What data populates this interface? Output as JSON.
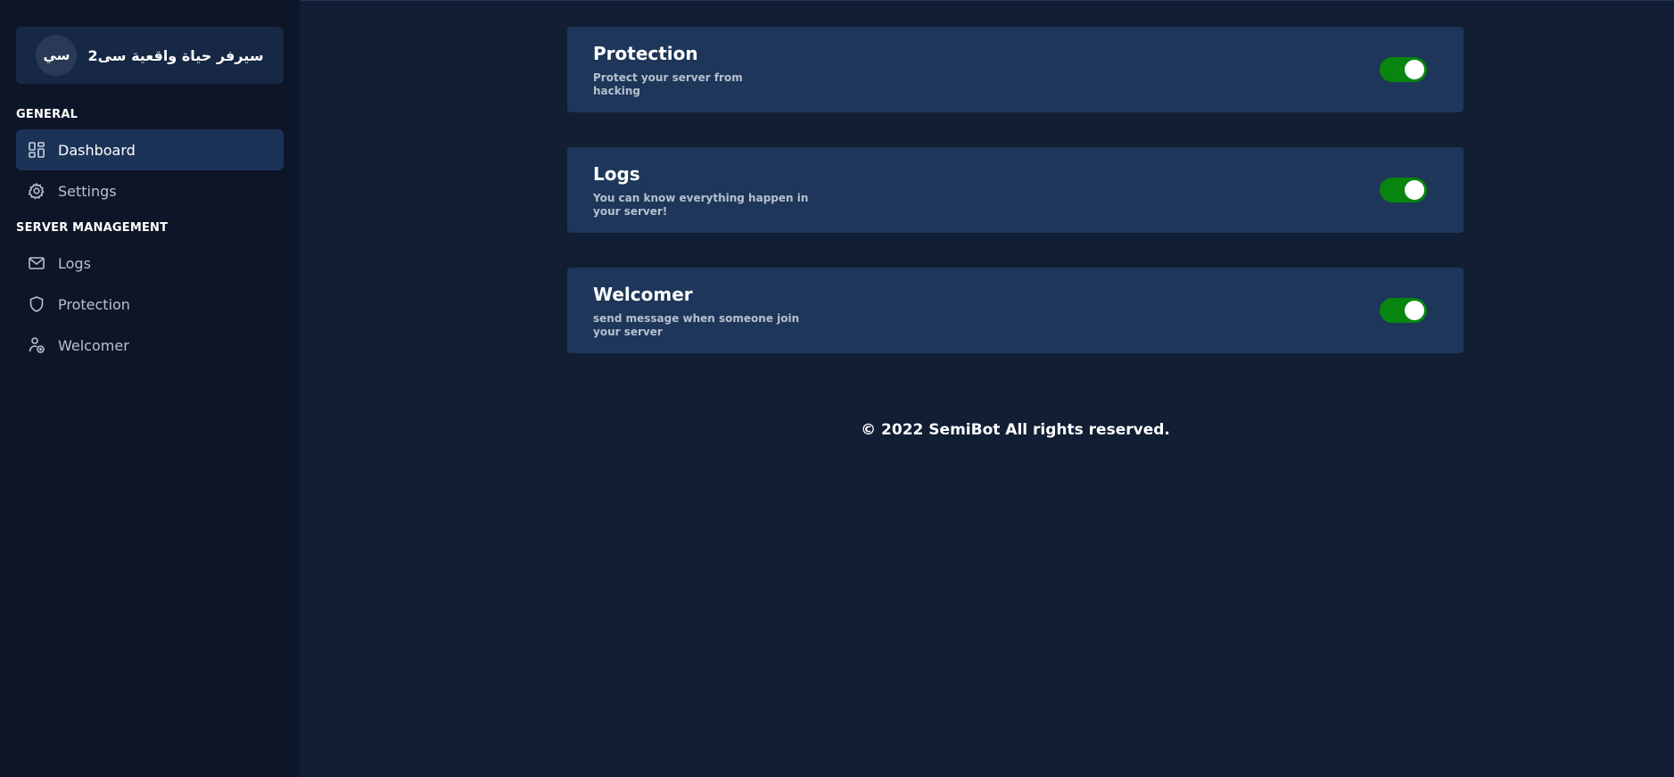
{
  "sidebar": {
    "server": {
      "avatar_text": "سي",
      "name": "سيرفر حياة واقعية سى2"
    },
    "sections": {
      "general": "GENERAL",
      "server_management": "SERVER MANAGEMENT"
    },
    "items": [
      {
        "label": "Dashboard",
        "icon": "dashboard-icon",
        "active": true
      },
      {
        "label": "Settings",
        "icon": "gear-icon",
        "active": false
      },
      {
        "label": "Logs",
        "icon": "envelope-icon",
        "active": false
      },
      {
        "label": "Protection",
        "icon": "shield-icon",
        "active": false
      },
      {
        "label": "Welcomer",
        "icon": "user-add-icon",
        "active": false
      }
    ]
  },
  "modules": [
    {
      "title": "Protection",
      "desc_line1": "Protect your server from",
      "desc_line2": "hacking",
      "enabled": true
    },
    {
      "title": "Logs",
      "desc_line1": "You can know everything happen in",
      "desc_line2": "your server!",
      "enabled": true
    },
    {
      "title": "Welcomer",
      "desc_line1": "send message when someone join",
      "desc_line2": "your server",
      "enabled": true
    }
  ],
  "footer": {
    "text": "© 2022 SemiBot All rights reserved."
  },
  "colors": {
    "accent_toggle": "#07850f",
    "card_bg": "#1d3659",
    "page_bg": "#111e33",
    "sidebar_bg": "#0d1628"
  }
}
